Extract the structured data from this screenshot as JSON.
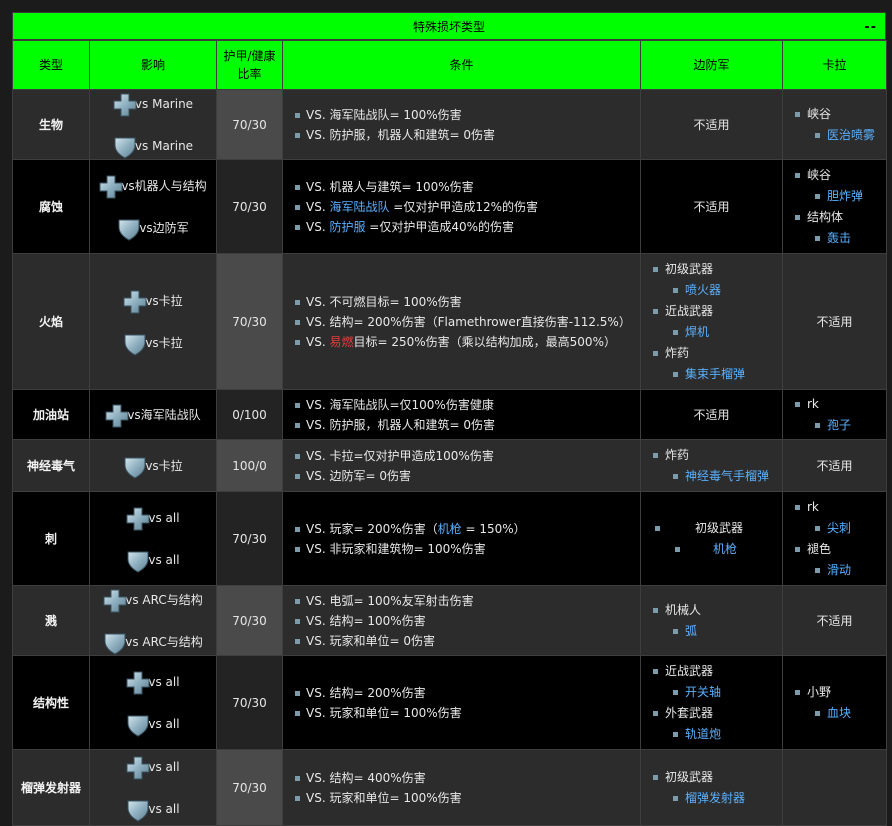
{
  "title": "特殊损坏类型",
  "collapse_label": "--",
  "headers": {
    "type": "类型",
    "effect": "影响",
    "ratio_line1": "护甲/健康",
    "ratio_line2": "比率",
    "condition": "条件",
    "borderguard": "边防军",
    "kara": "卡拉"
  },
  "colors": {
    "header_green": "#00ff00",
    "borderguard_blue": "#4db0ff",
    "kara_orange": "#ffa500",
    "link_blue": "#5ab0ff",
    "highlight_red": "#e0403a"
  },
  "icons": {
    "health": "health-cross-icon",
    "armor": "armor-shield-icon"
  },
  "rows": [
    {
      "type": "生物",
      "eff_health": "vs Marine",
      "eff_armor": "vs Marine",
      "ratio": "70/30",
      "cond": [
        "VS. 海军陆战队= 100%伤害",
        "VS. 防护服，机器人和建筑= 0伤害"
      ],
      "bg_text": "不适用",
      "kr": [
        {
          "g": "峡谷",
          "s": "医治喷雾"
        }
      ]
    },
    {
      "type": "腐蚀",
      "eff_health": "vs机器人与结构",
      "eff_armor": "vs边防军",
      "ratio": "70/30",
      "cond1": "VS. 机器人与建筑= 100%伤害",
      "cond2_pre": "VS. ",
      "cond2_link": "海军陆战队",
      "cond2_post": " =仅对护甲造成12%的伤害",
      "cond3_pre": "VS. ",
      "cond3_link": "防护服",
      "cond3_post": " =仅对护甲造成40%的伤害",
      "bg_text": "不适用",
      "kr": [
        {
          "g": "峡谷",
          "s": "胆炸弹"
        },
        {
          "g": "结构体",
          "s": "轰击"
        }
      ]
    },
    {
      "type": "火焰",
      "eff_health": "vs卡拉",
      "eff_armor": "vs卡拉",
      "ratio": "70/30",
      "cond1": "VS. 不可燃目标= 100%伤害",
      "cond2": "VS. 结构= 200%伤害（Flamethrower直接伤害-112.5%）",
      "cond3_pre": "VS. ",
      "cond3_red": "易燃",
      "cond3_post": "目标= 250%伤害（乘以结构加成，最高500%）",
      "bg": [
        {
          "g": "初级武器",
          "s": "喷火器"
        },
        {
          "g": "近战武器",
          "s": "焊机"
        },
        {
          "g": "炸药",
          "s": "集束手榴弹"
        }
      ],
      "kr_text": "不适用"
    },
    {
      "type": "加油站",
      "eff_health": "vs海军陆战队",
      "ratio": "0/100",
      "cond": [
        "VS. 海军陆战队=仅100%伤害健康",
        "VS. 防护服，机器人和建筑= 0伤害"
      ],
      "bg_text": "不适用",
      "kr": [
        {
          "g": "rk",
          "s": "孢子"
        }
      ]
    },
    {
      "type": "神经毒气",
      "eff_armor": "vs卡拉",
      "ratio": "100/0",
      "cond": [
        "VS. 卡拉=仅对护甲造成100%伤害",
        "VS. 边防军= 0伤害"
      ],
      "bg": [
        {
          "g": "炸药",
          "s": "神经毒气手榴弹"
        }
      ],
      "kr_text": "不适用"
    },
    {
      "type": "刺",
      "eff_health": "vs all",
      "eff_armor": "vs all",
      "ratio": "70/30",
      "cond1_pre": "VS. 玩家= 200%伤害（",
      "cond1_link": "机枪",
      "cond1_post": " = 150%）",
      "cond2": "VS. 非玩家和建筑物= 100%伤害",
      "bg": [
        {
          "g": "初级武器",
          "s": "机枪"
        }
      ],
      "kr": [
        {
          "g": "rk",
          "s": "尖刺"
        },
        {
          "g": "褪色",
          "s": "滑动"
        }
      ]
    },
    {
      "type": "溅",
      "eff_health": "vs ARC与结构",
      "eff_armor": "vs ARC与结构",
      "ratio": "70/30",
      "cond": [
        "VS. 电弧= 100%友军射击伤害",
        "VS. 结构= 100%伤害",
        "VS. 玩家和单位= 0伤害"
      ],
      "bg": [
        {
          "g": "机械人",
          "s": "弧"
        }
      ],
      "kr_text": "不适用"
    },
    {
      "type": "结构性",
      "eff_health": "vs all",
      "eff_armor": "vs all",
      "ratio": "70/30",
      "cond": [
        "VS. 结构= 200%伤害",
        "VS. 玩家和单位= 100%伤害"
      ],
      "bg": [
        {
          "g": "近战武器",
          "s": "开关轴"
        },
        {
          "g": "外套武器",
          "s": "轨道炮"
        }
      ],
      "kr": [
        {
          "g": "小野",
          "s": "血块"
        }
      ]
    },
    {
      "type": "榴弹发射器",
      "eff_health": "vs all",
      "eff_armor": "vs all",
      "ratio": "70/30",
      "cond": [
        "VS. 结构= 400%伤害",
        "VS. 玩家和单位= 100%伤害"
      ],
      "bg": [
        {
          "g": "初级武器",
          "s": "榴弹发射器"
        }
      ],
      "kr_text": ""
    }
  ]
}
